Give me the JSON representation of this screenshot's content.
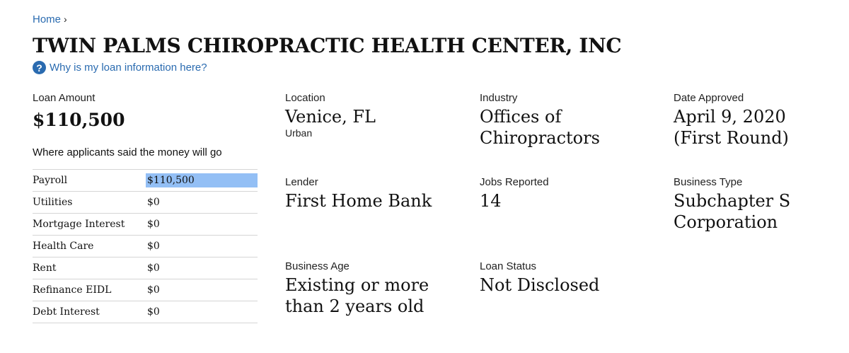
{
  "breadcrumb": {
    "home_label": "Home",
    "separator": "›"
  },
  "business": {
    "name": "TWIN PALMS CHIROPRACTIC HEALTH CENTER, INC"
  },
  "why_link": {
    "label": "Why is my loan information here?",
    "icon": "question-icon"
  },
  "loan_amount": {
    "label": "Loan Amount",
    "value": "$110,500"
  },
  "uses": {
    "heading": "Where applicants said the money will go",
    "rows": [
      {
        "category": "Payroll",
        "amount": "$110,500",
        "highlighted": true
      },
      {
        "category": "Utilities",
        "amount": "$0"
      },
      {
        "category": "Mortgage Interest",
        "amount": "$0"
      },
      {
        "category": "Health Care",
        "amount": "$0"
      },
      {
        "category": "Rent",
        "amount": "$0"
      },
      {
        "category": "Refinance EIDL",
        "amount": "$0"
      },
      {
        "category": "Debt Interest",
        "amount": "$0"
      }
    ]
  },
  "location": {
    "label": "Location",
    "value": "Venice, FL",
    "sub": "Urban"
  },
  "industry": {
    "label": "Industry",
    "value": "Offices of Chiropractors"
  },
  "date_approved": {
    "label": "Date Approved",
    "value": "April 9, 2020 (First Round)"
  },
  "lender": {
    "label": "Lender",
    "value": "First Home Bank"
  },
  "jobs_reported": {
    "label": "Jobs Reported",
    "value": "14"
  },
  "business_type": {
    "label": "Business Type",
    "value": "Subchapter S Corporation"
  },
  "business_age": {
    "label": "Business Age",
    "value": "Existing or more than 2 years old"
  },
  "loan_status": {
    "label": "Loan Status",
    "value": "Not Disclosed"
  },
  "colors": {
    "link": "#2a6bb0",
    "highlight": "#93bff5",
    "text": "#111111",
    "divider": "#d5d5d5"
  }
}
